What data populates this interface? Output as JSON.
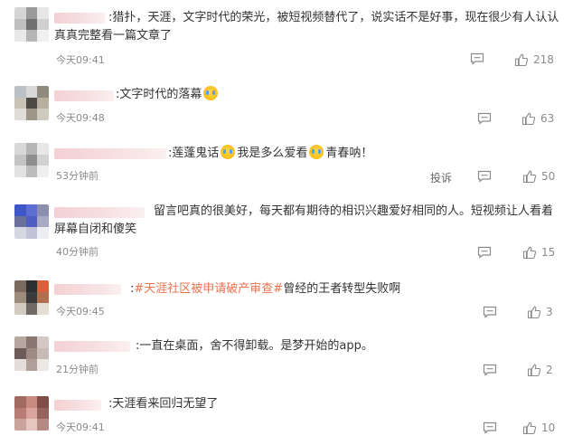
{
  "comments": [
    {
      "text_parts": [
        ":",
        "猎扑，天涯，文字时代的荣光，被短视频替代了，说实话不是好事，现在很少有人认认真真完整看一篇文章了"
      ],
      "time": "今天09:41",
      "likes": "218",
      "avatar_colors": [
        "#d5d5d5",
        "#9a9a9a",
        "#e6e6e6",
        "#bfbfbf",
        "#6f6f6f",
        "#d0d0d0",
        "#e9e9e9",
        "#b5b5b5",
        "#f0f0f0"
      ]
    },
    {
      "text_parts": [
        ":",
        "文字时代的落幕"
      ],
      "time": "今天09:48",
      "likes": "63",
      "avatar_colors": [
        "#b9c1c4",
        "#d8d8d8",
        "#8e8a7e",
        "#c9c2b7",
        "#4c4a42",
        "#b8b09e",
        "#e0ddd6",
        "#9d9687",
        "#cfcabf"
      ]
    },
    {
      "text_parts": [
        ":",
        "莲蓬鬼话",
        "我是多么爱看",
        "青春呐！"
      ],
      "time": "53分钟前",
      "report": "投诉",
      "likes": "50",
      "avatar_colors": [
        "#d8d8d8",
        "#b5b5b5",
        "#e7e7e7",
        "#c4c4c4",
        "#8e8e8e",
        "#d2d2d2",
        "#e2e2e2",
        "#bcbcbc",
        "#efefef"
      ]
    },
    {
      "text_parts": [
        "留言吧真的很美好，每天都有期待的相识兴趣爱好相同的人。短视频让人看着屏幕自闭和傻笑"
      ],
      "time": "40分钟前",
      "likes": "15",
      "avatar_colors": [
        "#3f56c8",
        "#5d6fd3",
        "#8d8fb1",
        "#6b6f9c",
        "#4f5fc1",
        "#a8aac4",
        "#d7d7e4",
        "#c2c3d6",
        "#eceef4"
      ]
    },
    {
      "text_parts": [
        ":",
        "#天涯社区被申请破产审查#",
        "曾经的王者转型失败啊"
      ],
      "time": "今天09:45",
      "likes": "3",
      "avatar_colors": [
        "#7b6a5f",
        "#2d2e30",
        "#d9623e",
        "#9d8b7c",
        "#3a3b3d",
        "#b0704f",
        "#d3cbc2",
        "#6f6a66",
        "#e4ddd4"
      ]
    },
    {
      "text_parts": [
        ":",
        "一直在桌面，舍不得卸载。是梦开始的app。"
      ],
      "time": "21分钟前",
      "likes": "2",
      "avatar_colors": [
        "#b7a7a1",
        "#8a7670",
        "#d3c8c3",
        "#6c5b56",
        "#9e8b84",
        "#c7bbb6",
        "#e4ddda",
        "#b09f99",
        "#ede7e4"
      ]
    },
    {
      "text_parts": [
        ":",
        "天涯看来回归无望了"
      ],
      "time": "今天09:41",
      "likes": "10",
      "avatar_colors": [
        "#a06a60",
        "#c98a80",
        "#7e4e47",
        "#b77c73",
        "#d9a49b",
        "#93635c",
        "#caa39c",
        "#e6c6c0",
        "#b58a84"
      ]
    }
  ],
  "icons": {
    "reply": "comment-bubble-icon",
    "like": "thumbs-up-icon",
    "emoji": "crying-face-emoji"
  },
  "colors": {
    "text": "#333333",
    "meta": "#8a8a8a",
    "highlight": "#eb7350"
  }
}
